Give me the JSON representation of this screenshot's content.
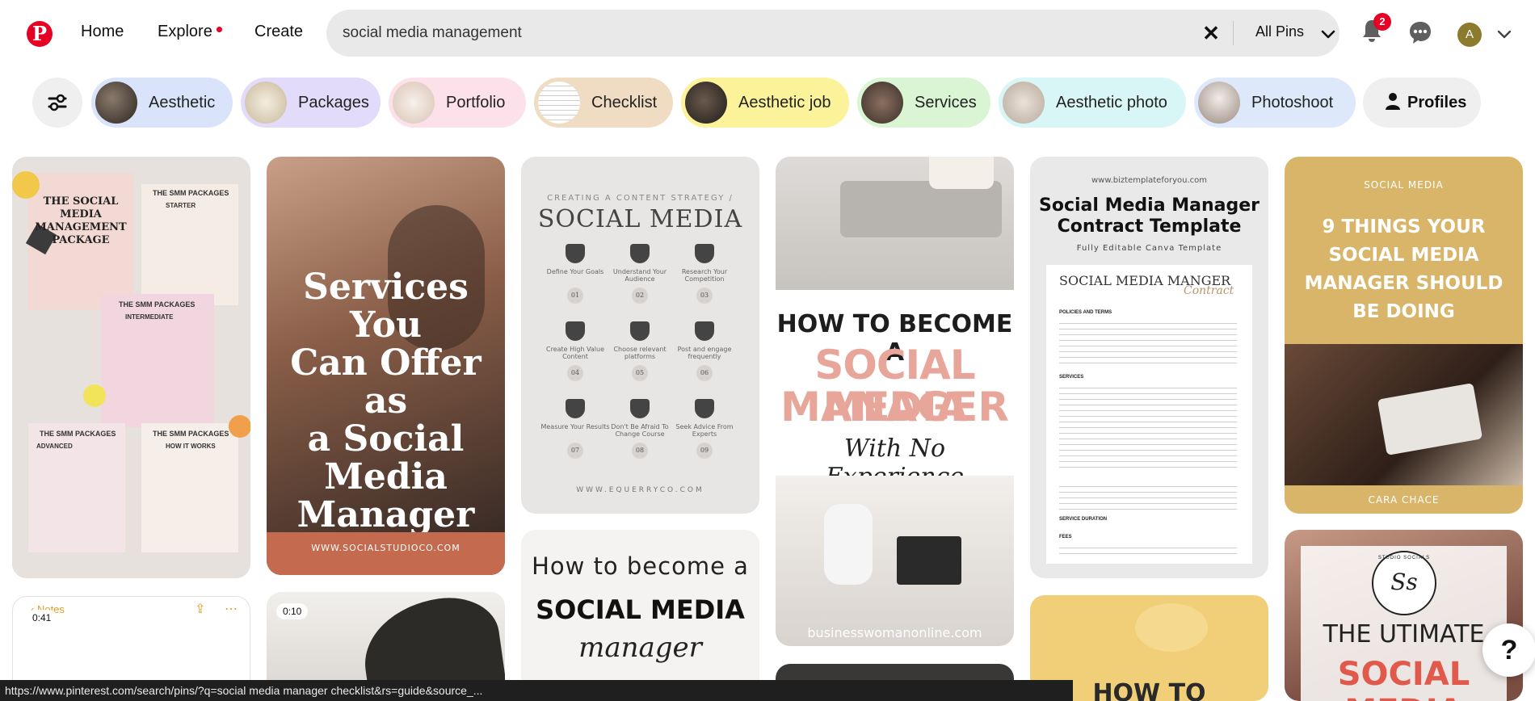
{
  "header": {
    "logo": "P",
    "nav": {
      "home": "Home",
      "explore": "Explore",
      "create": "Create"
    },
    "search": {
      "value": "social media management",
      "clear": "✕",
      "filter": "All Pins"
    },
    "notifications_count": "2",
    "avatar_initial": "A"
  },
  "chips": [
    {
      "label": "Aesthetic",
      "bg": "#d9e4fb"
    },
    {
      "label": "Packages",
      "bg": "#e2dcfa"
    },
    {
      "label": "Portfolio",
      "bg": "#fde1ea"
    },
    {
      "label": "Checklist",
      "bg": "#efdcc2"
    },
    {
      "label": "Aesthetic job",
      "bg": "#fbf29a"
    },
    {
      "label": "Services",
      "bg": "#d9f5d3"
    },
    {
      "label": "Aesthetic photo",
      "bg": "#d9f6f6"
    },
    {
      "label": "Photoshoot",
      "bg": "#dde8fb"
    }
  ],
  "profiles_chip": "Profiles",
  "pins": {
    "p1": {
      "title": "THE SOCIAL MEDIA MANAGEMENT PACKAGE",
      "h1": "THE SMM PACKAGES",
      "s1": "STARTER",
      "h2": "THE SMM PACKAGES",
      "s2": "INTERMEDIATE",
      "h3": "THE SMM PACKAGES",
      "s3": "ADVANCED",
      "h4": "THE SMM PACKAGES",
      "s4": "HOW IT WORKS"
    },
    "p2": {
      "line1": "Services You",
      "line2": "Can Offer as",
      "line3": "a Social",
      "line4": "Media",
      "line5": "Manager",
      "url": "WWW.SOCIALSTUDIOCO.COM"
    },
    "p3": {
      "kicker": "CREATING A CONTENT STRATEGY /",
      "title": "SOCIAL MEDIA",
      "steps": [
        "Define Your Goals",
        "Understand Your Audience",
        "Research Your Competition",
        "Create High Value Content",
        "Choose relevant platforms",
        "Post and engage frequently",
        "Measure Your Results",
        "Don't Be Afraid To Change Course",
        "Seek Advice From Experts"
      ],
      "nums": [
        "01",
        "02",
        "03",
        "04",
        "05",
        "06",
        "07",
        "08",
        "09"
      ],
      "url": "WWW.EQUERRYCO.COM"
    },
    "p4": {
      "line1": "HOW TO BECOME A",
      "line2": "SOCIAL MEDIA",
      "line3": "MANAGER",
      "line4": "With No Experience",
      "url": "businesswomanonline.com"
    },
    "p5": {
      "url": "www.biztemplateforyou.com",
      "title1": "Social Media Manager",
      "title2": "Contract Template",
      "sub": "Fully Editable Canva Template",
      "doc_title": "SOCIAL MEDIA MANGER",
      "doc_script": "Contract",
      "sec1": "POLICIES AND TERMS",
      "sec2": "SERVICES",
      "sec3": "SERVICE DURATION",
      "sec4": "FEES"
    },
    "p6": {
      "kicker": "SOCIAL MEDIA",
      "line1": "9 THINGS YOUR",
      "line2": "SOCIAL MEDIA",
      "line3": "MANAGER SHOULD",
      "line4": "BE DOING",
      "brand": "CARA CHACE"
    },
    "p7": {
      "back": "Notes",
      "time": "0:41"
    },
    "p8": {
      "time": "0:10"
    },
    "p9": {
      "line1": "How to become a",
      "line2": "SOCIAL MEDIA",
      "line3": "manager"
    },
    "p11": {
      "line1": "HOW TO"
    },
    "p12": {
      "monogram": "Ss",
      "ring": "STUDIO SOCIALS",
      "line1": "THE UTIMATE",
      "line2": "SOCIAL MEDIA"
    }
  },
  "help": "?",
  "status_url": "https://www.pinterest.com/search/pins/?q=social media manager checklist&rs=guide&source_..."
}
